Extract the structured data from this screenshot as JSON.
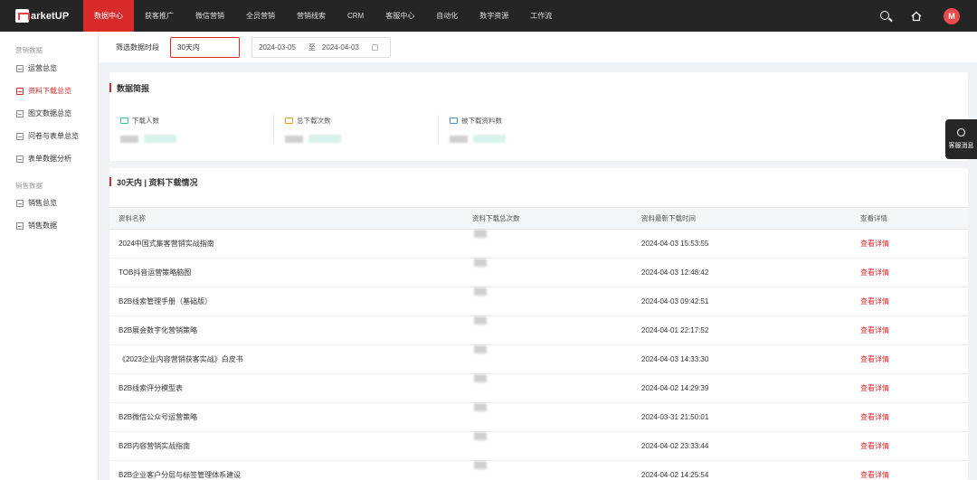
{
  "app": {
    "logo_text": "arketUP"
  },
  "topnav": {
    "items": [
      "数据中心",
      "获客推广",
      "微信营销",
      "全员营销",
      "营销线索",
      "CRM",
      "客服中心",
      "自动化",
      "数字资源",
      "工作流"
    ],
    "active_index": 0,
    "accent": "#d92a2a"
  },
  "sidebar": {
    "sections": [
      {
        "title": "营销数据",
        "items": [
          "运营总览",
          "资料下载总览",
          "图文数据总览",
          "问卷与表单总览",
          "表单数据分析"
        ]
      },
      {
        "title": "销售数据",
        "items": [
          "销售总览",
          "销售数据"
        ]
      }
    ],
    "active_item": "资料下载总览"
  },
  "filter": {
    "label": "筛选数据时段",
    "period": "30天内",
    "start_date": "2024-03-05",
    "range_sep": "至",
    "end_date": "2024-04-03"
  },
  "summary": {
    "title": "数据简报",
    "stats": [
      {
        "label": "下载人数",
        "icon": "monitor-icon",
        "color": "#3bbf9a"
      },
      {
        "label": "总下载次数",
        "icon": "download-icon",
        "color": "#e0a020"
      },
      {
        "label": "被下载资料数",
        "icon": "file-icon",
        "color": "#4a90d9"
      }
    ]
  },
  "table": {
    "title": "30天内 | 资料下载情况",
    "columns": [
      "资料名称",
      "资料下载总次数",
      "资料最新下载时间",
      "查看详情"
    ],
    "rows": [
      {
        "name": "2024中国式集客营销实战指南",
        "time": "2024-04-03 15:53:55",
        "action": "查看详情"
      },
      {
        "name": "TOB抖音运营策略脑图",
        "time": "2024-04-03 12:48:42",
        "action": "查看详情"
      },
      {
        "name": "B2B线索管理手册（基础版）",
        "time": "2024-04-03 09:42:51",
        "action": "查看详情"
      },
      {
        "name": "B2B展会数字化营销策略",
        "time": "2024-04-01 22:17:52",
        "action": "查看详情"
      },
      {
        "name": "《2023企业内容营销获客实战》白皮书",
        "time": "2024-04-03 14:33:30",
        "action": "查看详情"
      },
      {
        "name": "B2B线索评分模型表",
        "time": "2024-04-02 14:29:39",
        "action": "查看详情"
      },
      {
        "name": "B2B微信公众号运营策略",
        "time": "2024-03-31 21:50:01",
        "action": "查看详情"
      },
      {
        "name": "B2B内容营销实战指南",
        "time": "2024-04-02 23:33:44",
        "action": "查看详情"
      },
      {
        "name": "B2B企业客户分层与标签管理体系建设",
        "time": "2024-04-02 14:25:54",
        "action": "查看详情"
      }
    ]
  },
  "service_tab": {
    "label": "客服消息"
  }
}
